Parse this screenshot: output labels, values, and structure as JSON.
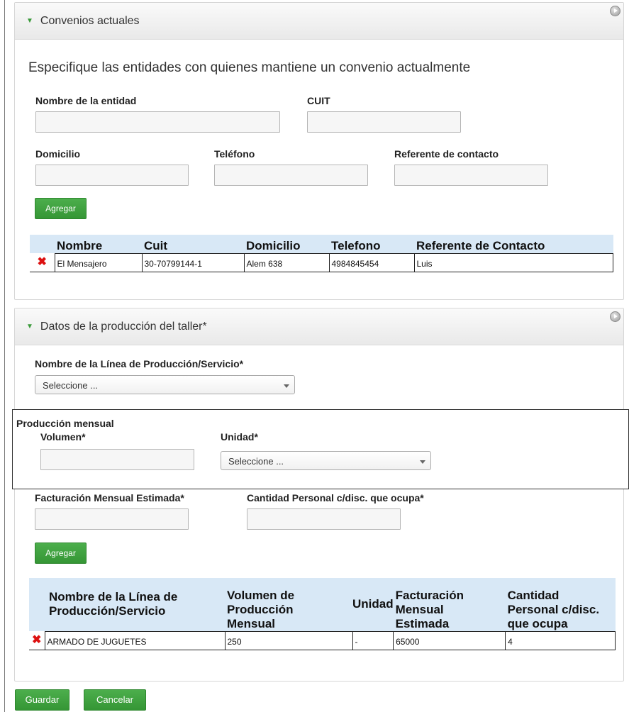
{
  "convenios": {
    "title": "Convenios actuales",
    "subtitle": "Especifique las entidades con quienes mantiene un convenio actualmente",
    "fields": {
      "nombre_label": "Nombre de la entidad",
      "cuit_label": "CUIT",
      "domicilio_label": "Domicilio",
      "telefono_label": "Teléfono",
      "referente_label": "Referente de contacto"
    },
    "add_button": "Agregar",
    "table": {
      "headers": [
        "Nombre",
        "Cuit",
        "Domicilio",
        "Telefono",
        "Referente de Contacto"
      ],
      "rows": [
        [
          "El Mensajero",
          "30-70799144-1",
          "Alem 638",
          "4984845454",
          "Luis"
        ]
      ]
    }
  },
  "produccion": {
    "title": "Datos de la producción del taller*",
    "linea_label": "Nombre de la Línea de Producción/Servicio*",
    "linea_select": "Seleccione ...",
    "mensual_group_label": "Producción mensual",
    "volumen_label": "Volumen*",
    "unidad_label": "Unidad*",
    "unidad_select": "Seleccione ...",
    "facturacion_label": "Facturación Mensual Estimada*",
    "cantidad_label": "Cantidad Personal c/disc. que ocupa*",
    "add_button": "Agregar",
    "table": {
      "headers": [
        [
          "Nombre de la Línea de",
          "Producción/Servicio"
        ],
        [
          "Volumen de",
          "Producción",
          "Mensual"
        ],
        [
          "Unidad"
        ],
        [
          "Facturación",
          "Mensual",
          "Estimada"
        ],
        [
          "Cantidad",
          "Personal c/disc.",
          "que ocupa"
        ]
      ],
      "rows": [
        [
          "ARMADO DE JUGUETES",
          "250",
          "-",
          "65000",
          "4"
        ]
      ]
    }
  },
  "footer": {
    "save_button": "Guardar",
    "cancel_button": "Cancelar"
  },
  "colors": {
    "accent_green": "#3fa33f",
    "table_header_blue": "#d8e8f6",
    "delete_red": "#dd1111"
  },
  "icons": {
    "collapse": "triangle-down-icon",
    "panel_pin": "pin-icon",
    "delete_row": "delete-x-icon",
    "dropdown": "chevron-down-icon"
  }
}
